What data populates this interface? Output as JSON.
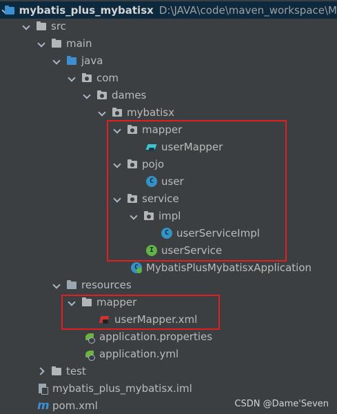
{
  "project": {
    "name": "mybatis_plus_mybatisx",
    "path": "D:\\JAVA\\code\\maven_workspace\\M"
  },
  "tree": {
    "src": "src",
    "main": "main",
    "java": "java",
    "com": "com",
    "dames": "dames",
    "mybatisx": "mybatisx",
    "mapper": "mapper",
    "userMapper": "userMapper",
    "pojo": "pojo",
    "user": "user",
    "service": "service",
    "impl": "impl",
    "userServiceImpl": "userServiceImpl",
    "userService": "userService",
    "app": "MybatisPlusMybatisxApplication",
    "resources": "resources",
    "res_mapper": "mapper",
    "userMapper_xml": "userMapper.xml",
    "app_props": "application.properties",
    "app_yml": "application.yml",
    "test": "test",
    "iml": "mybatis_plus_mybatisx.iml",
    "pom": "pom.xml"
  },
  "icon_letters": {
    "class": "C",
    "interface": "I",
    "maven": "m"
  },
  "watermark": "CSDN @Dame'Seven",
  "colors": {
    "background": "#3c3f41",
    "selected_row": "#0d293e",
    "highlight_box": "#e02020",
    "class_icon": "#3592c4",
    "interface_icon": "#62b543"
  }
}
